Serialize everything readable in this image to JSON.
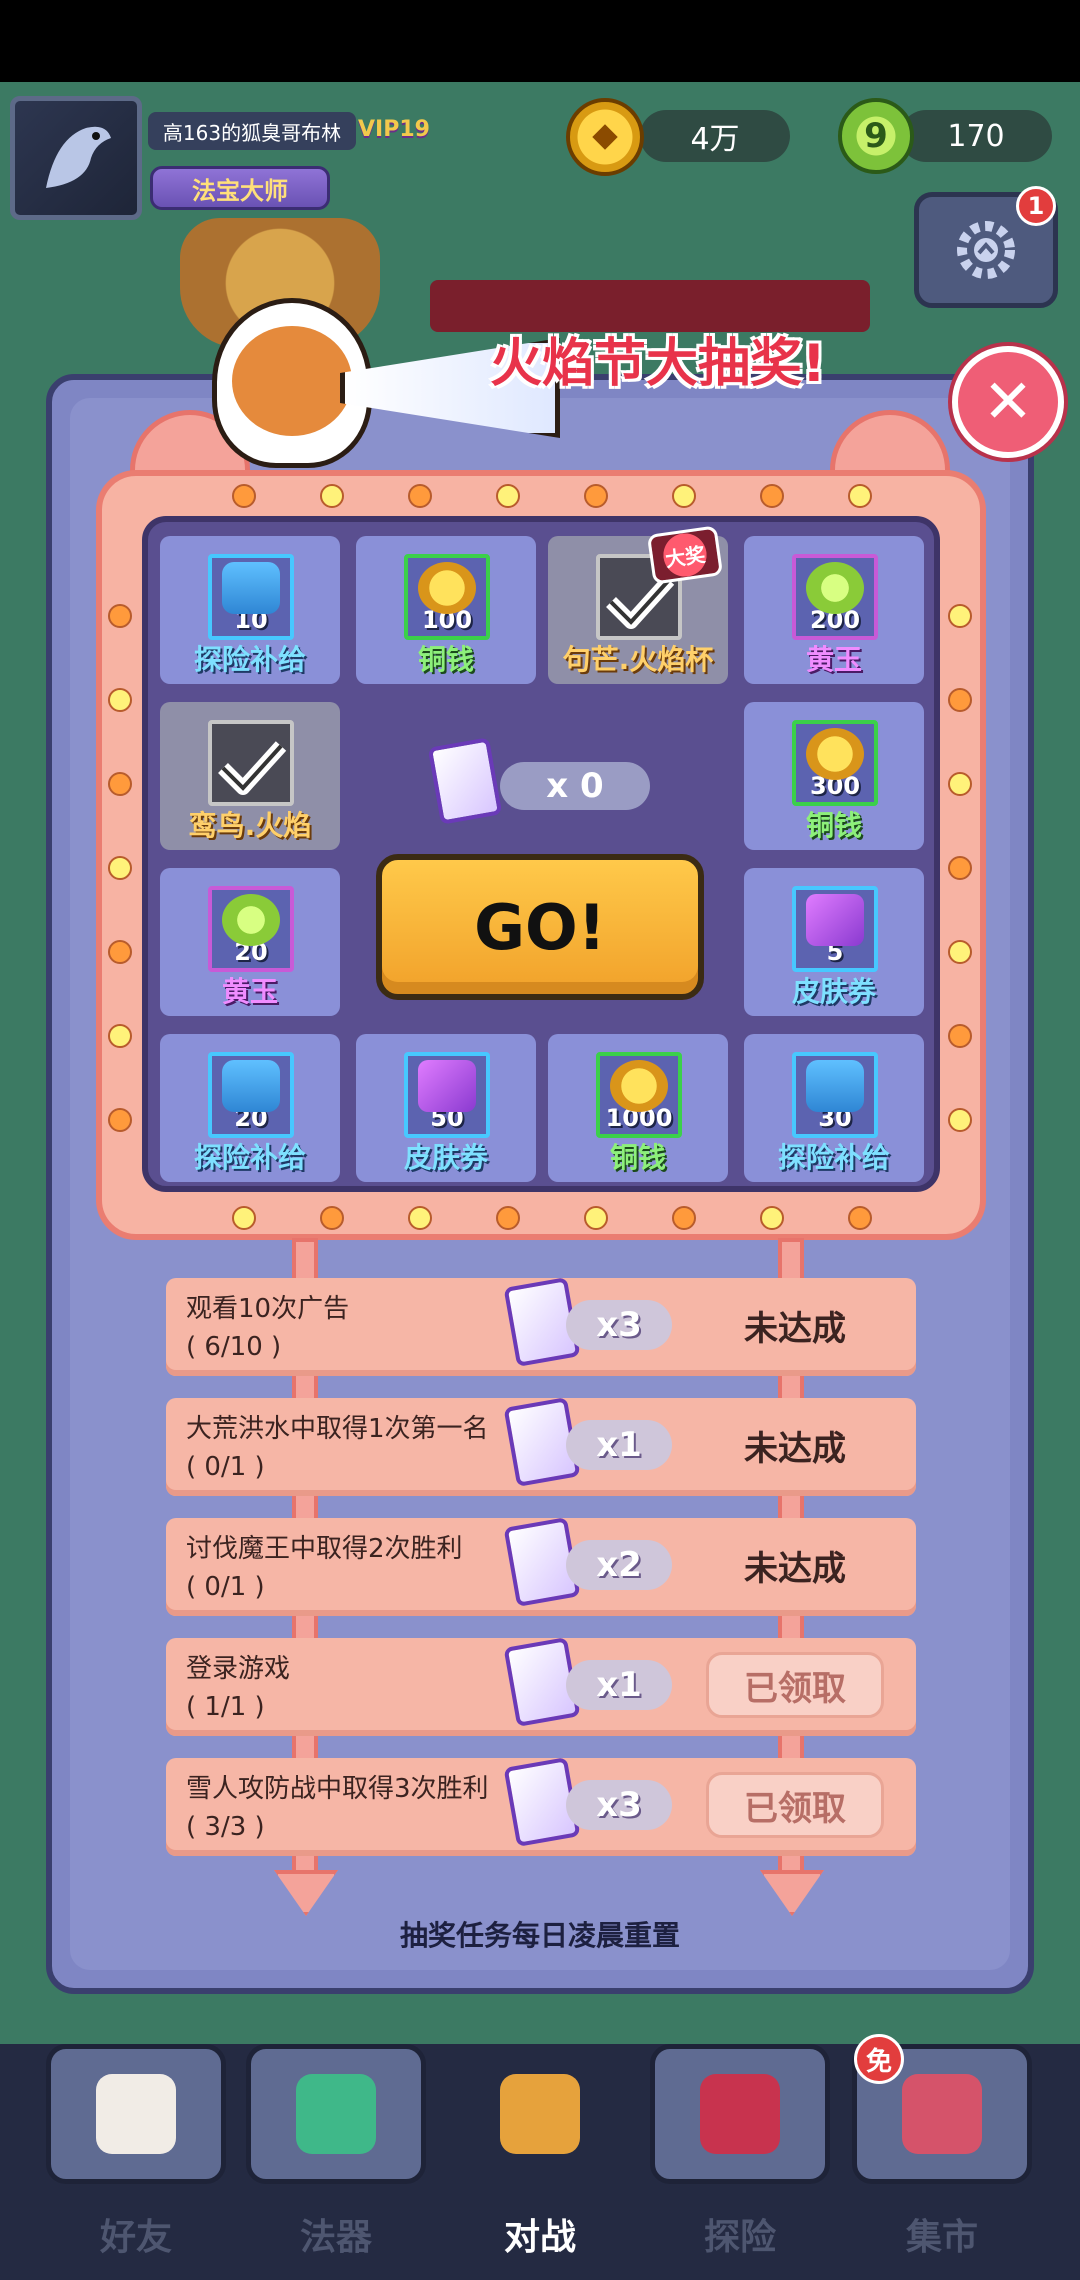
{
  "player": {
    "name": "高163的狐臭哥布林",
    "vip": "VIP19",
    "title": "法宝大师"
  },
  "currency": {
    "coins": "4万",
    "jade": "170"
  },
  "settings_badge": "1",
  "event": {
    "title": "火焰节大抽奖!"
  },
  "prizes": [
    {
      "name": "探险补给",
      "qty": "10",
      "icon": "supply-pack-icon",
      "color": "blue"
    },
    {
      "name": "铜钱",
      "qty": "100",
      "icon": "coin-icon",
      "color": "green"
    },
    {
      "name": "句芒.火焰杯",
      "qty": "",
      "icon": "skin-figure-icon",
      "color": "orange",
      "claimed": true,
      "badge": "大奖"
    },
    {
      "name": "黄玉",
      "qty": "200",
      "icon": "jade-icon",
      "color": "purple"
    },
    {
      "name": "铜钱",
      "qty": "300",
      "icon": "coin-icon",
      "color": "green"
    },
    {
      "name": "皮肤券",
      "qty": "5",
      "icon": "skin-ticket-icon",
      "color": "blue"
    },
    {
      "name": "探险补给",
      "qty": "30",
      "icon": "supply-pack-icon",
      "color": "blue"
    },
    {
      "name": "铜钱",
      "qty": "1000",
      "icon": "coin-icon",
      "color": "green"
    },
    {
      "name": "皮肤券",
      "qty": "50",
      "icon": "skin-ticket-icon",
      "color": "blue"
    },
    {
      "name": "探险补给",
      "qty": "20",
      "icon": "supply-pack-icon",
      "color": "blue"
    },
    {
      "name": "黄玉",
      "qty": "20",
      "icon": "jade-icon",
      "color": "purple"
    },
    {
      "name": "鸾鸟.火焰",
      "qty": "",
      "icon": "skin-figure-icon",
      "color": "orange",
      "claimed": true
    }
  ],
  "ticket_count": "x 0",
  "go_label": "GO!",
  "tasks": [
    {
      "title": "观看10次广告",
      "progress": "( 6/10 )",
      "reward": "x3",
      "status": "未达成",
      "claimed": false
    },
    {
      "title": "大荒洪水中取得1次第一名",
      "progress": "( 0/1 )",
      "reward": "x1",
      "status": "未达成",
      "claimed": false
    },
    {
      "title": "讨伐魔王中取得2次胜利",
      "progress": "( 0/1 )",
      "reward": "x2",
      "status": "未达成",
      "claimed": false
    },
    {
      "title": "登录游戏",
      "progress": "( 1/1 )",
      "reward": "x1",
      "status": "已领取",
      "claimed": true
    },
    {
      "title": "雪人攻防战中取得3次胜利",
      "progress": "( 3/3 )",
      "reward": "x3",
      "status": "已领取",
      "claimed": true
    }
  ],
  "reset_note": "抽奖任务每日凌晨重置",
  "nav": [
    {
      "label": "好友",
      "icon": "paw-icon"
    },
    {
      "label": "法器",
      "icon": "umbrella-icon"
    },
    {
      "label": "对战",
      "icon": "crossed-swords-icon",
      "active": true
    },
    {
      "label": "探险",
      "icon": "cards-icon"
    },
    {
      "label": "集市",
      "icon": "shop-icon"
    }
  ],
  "nav_free_badge": "免"
}
